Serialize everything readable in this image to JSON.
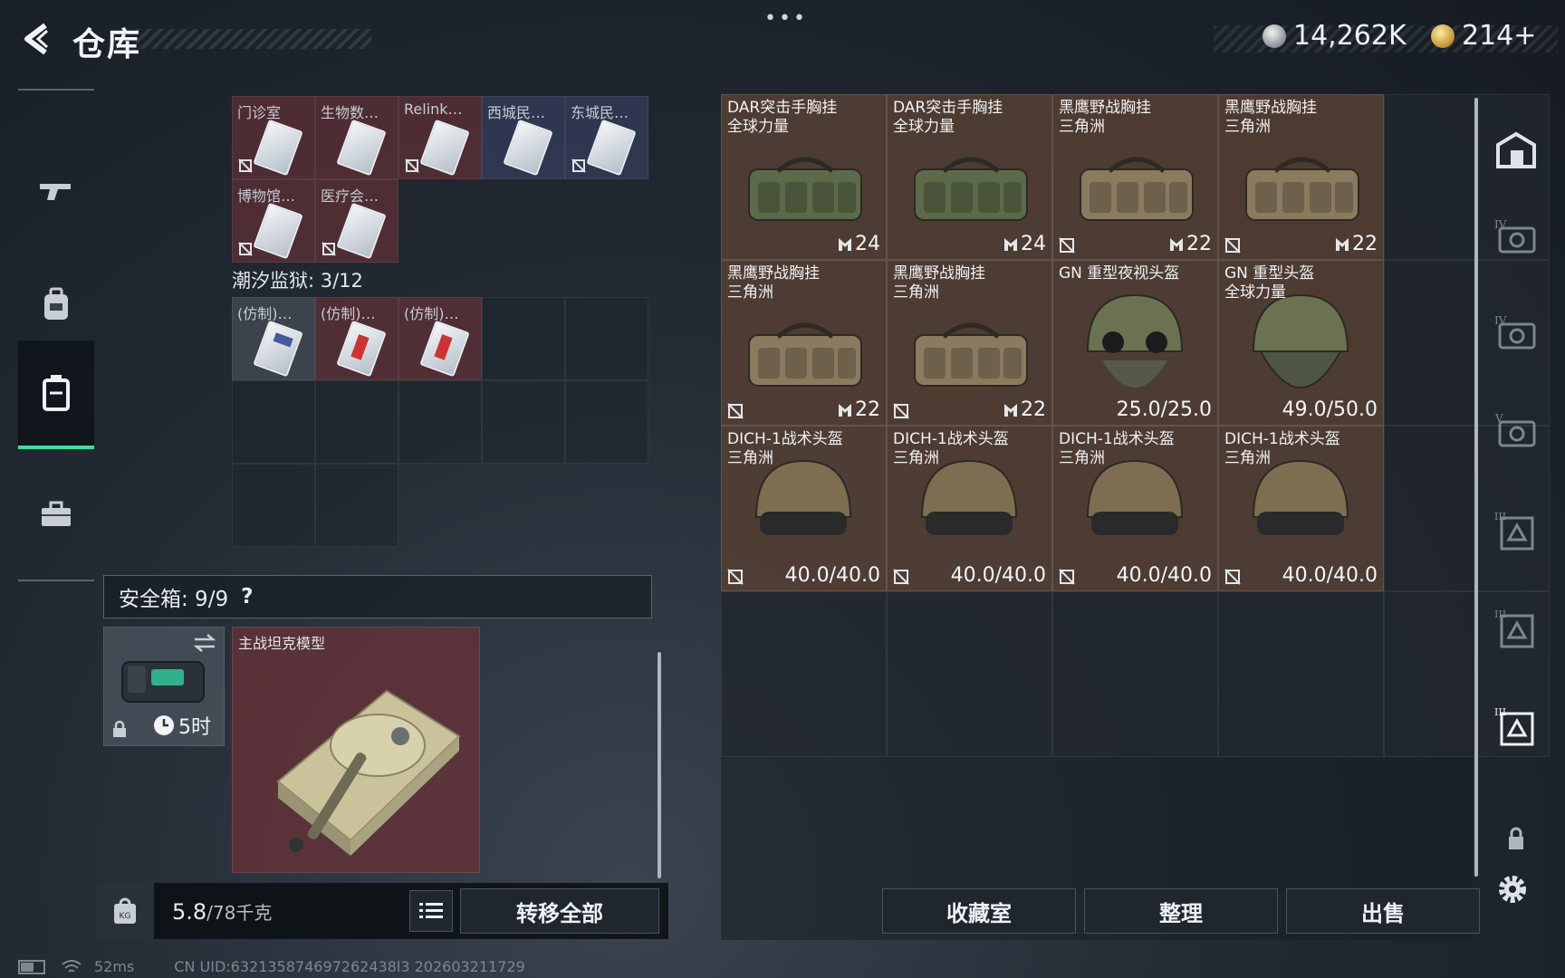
{
  "header": {
    "title": "仓库",
    "menu_dots": "•••",
    "currency_silver": "14,262K",
    "currency_gold": "214+"
  },
  "left_nav": {
    "items": [
      {
        "icon": "gun-icon",
        "active": false
      },
      {
        "icon": "backpack-icon",
        "active": false
      },
      {
        "icon": "rig-icon",
        "active": true
      },
      {
        "icon": "briefcase-icon",
        "active": false
      }
    ]
  },
  "keycards_top": {
    "row1": [
      "门诊室",
      "生物数…",
      "Relink…",
      "西城民…",
      "东城民…"
    ],
    "row2": [
      "博物馆…",
      "医疗会…"
    ]
  },
  "prison": {
    "label": "潮汐监狱: 3/12",
    "items": [
      "(仿制)…",
      "(仿制)…",
      "(仿制)…"
    ]
  },
  "safebox": {
    "label": "安全箱: 9/9",
    "help": "?",
    "timer": "5时",
    "tank_name": "主战坦克模型"
  },
  "bottom_left": {
    "weight_current": "5.8",
    "weight_max": "/78千克",
    "transfer_all": "转移全部"
  },
  "stash_items": [
    {
      "name": "DAR突击手胸挂\n全球力量",
      "value": "24",
      "type": "vest",
      "color": "#5d6a4a"
    },
    {
      "name": "DAR突击手胸挂\n全球力量",
      "value": "24",
      "type": "vest",
      "color": "#5d6a4a"
    },
    {
      "name": "黑鹰野战胸挂\n三角洲",
      "value": "22",
      "type": "vest",
      "color": "#8a7a5e"
    },
    {
      "name": "黑鹰野战胸挂\n三角洲",
      "value": "22",
      "type": "vest",
      "color": "#8a7a5e"
    },
    {
      "name": "黑鹰野战胸挂\n三角洲",
      "value": "22",
      "type": "vest",
      "color": "#8a7a5e"
    },
    {
      "name": "黑鹰野战胸挂\n三角洲",
      "value": "22",
      "type": "vest",
      "color": "#8a7a5e"
    },
    {
      "name": "GN 重型夜视头盔",
      "value": "25.0/25.0",
      "type": "helmet-nv",
      "color": "#6a7252"
    },
    {
      "name": "GN 重型头盔\n全球力量",
      "value": "49.0/50.0",
      "type": "helmet-heavy",
      "color": "#6a7252"
    },
    {
      "name": "DICH-1战术头盔\n三角洲",
      "value": "40.0/40.0",
      "type": "helmet",
      "color": "#7d6e52"
    },
    {
      "name": "DICH-1战术头盔\n三角洲",
      "value": "40.0/40.0",
      "type": "helmet",
      "color": "#7d6e52"
    },
    {
      "name": "DICH-1战术头盔\n三角洲",
      "value": "40.0/40.0",
      "type": "helmet",
      "color": "#7d6e52"
    },
    {
      "name": "DICH-1战术头盔\n三角洲",
      "value": "40.0/40.0",
      "type": "helmet",
      "color": "#7d6e52"
    }
  ],
  "right_nav": {
    "items": [
      "stash-tab-main-icon",
      "stash-tab-IV-1-icon",
      "stash-tab-IV-2-icon",
      "stash-tab-V-icon",
      "stash-tab-III-1-icon",
      "stash-tab-III-2-icon",
      "stash-tab-III-3-icon",
      "lock-icon"
    ]
  },
  "bottom_right": {
    "collection": "收藏室",
    "organize": "整理",
    "sell": "出售"
  },
  "status": {
    "ping": "52ms",
    "uid": "CN UID:632135874697262438l3 202603211729"
  }
}
